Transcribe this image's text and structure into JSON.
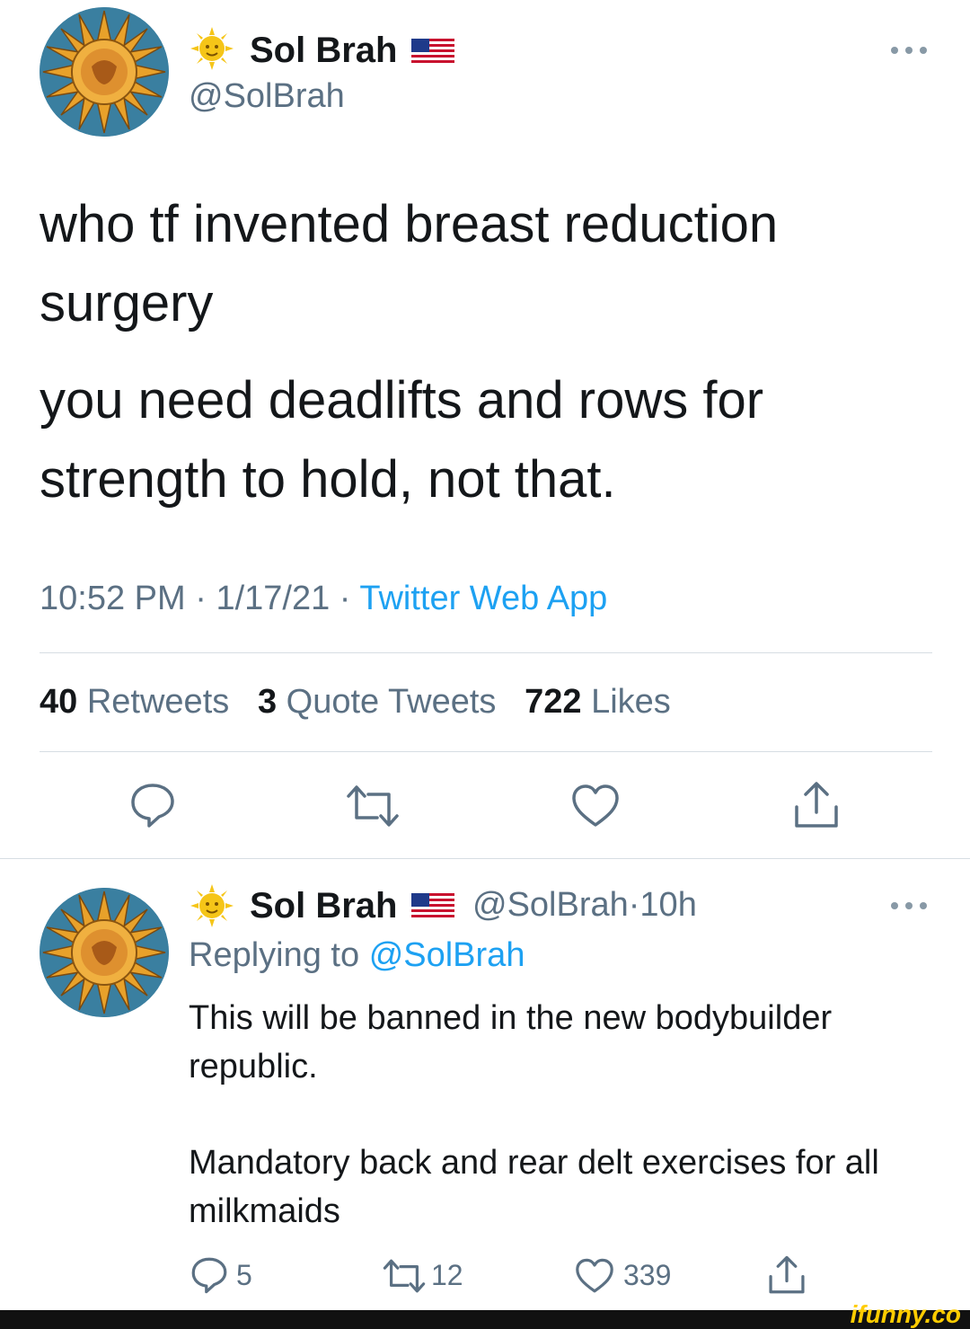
{
  "main_tweet": {
    "avatar_icon": "sun-bodybuilder-avatar",
    "name_emoji": "sun-face-icon",
    "name": "Sol Brah",
    "flag_icon": "us-flag-icon",
    "handle": "@SolBrah",
    "text_line1": "who tf invented breast reduction surgery",
    "text_line2": "you need deadlifts and rows for strength to hold, not that.",
    "time": "10:52 PM",
    "date": "1/17/21",
    "source": "Twitter Web App",
    "separator": "·",
    "more_icon": "more-dots-icon",
    "stats": {
      "retweets_count": "40",
      "retweets_label": "Retweets",
      "quotes_count": "3",
      "quotes_label": "Quote Tweets",
      "likes_count": "722",
      "likes_label": "Likes"
    },
    "actions": [
      "reply-icon",
      "retweet-icon",
      "like-icon",
      "share-icon"
    ]
  },
  "reply_tweet": {
    "name": "Sol Brah",
    "handle": "@SolBrah",
    "separator": "·",
    "age": "10h",
    "replying_prefix": "Replying to",
    "replying_handle": "@SolBrah",
    "text_line1": "This will be banned in the new bodybuilder republic.",
    "text_line2": "Mandatory back and rear delt exercises for all milkmaids",
    "reply_count": "5",
    "retweet_count": "12",
    "like_count": "339"
  },
  "watermark": "ifunny.co",
  "colors": {
    "link": "#1da1f2",
    "secondary_text": "#5b7083",
    "primary_text": "#14171a",
    "watermark": "#ffcc00"
  }
}
